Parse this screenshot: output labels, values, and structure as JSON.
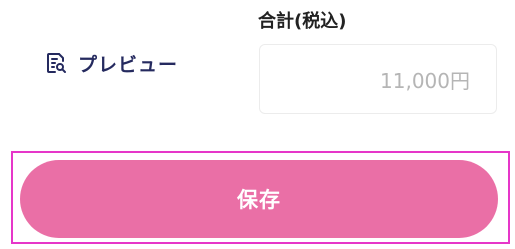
{
  "preview": {
    "label": "プレビュー",
    "icon": "document-search-icon",
    "color": "#252a5f"
  },
  "total": {
    "label": "合計(税込)",
    "value": "11,000円"
  },
  "save": {
    "label": "保存",
    "color": "#ea6fa6",
    "highlight_color": "#e636c9"
  }
}
